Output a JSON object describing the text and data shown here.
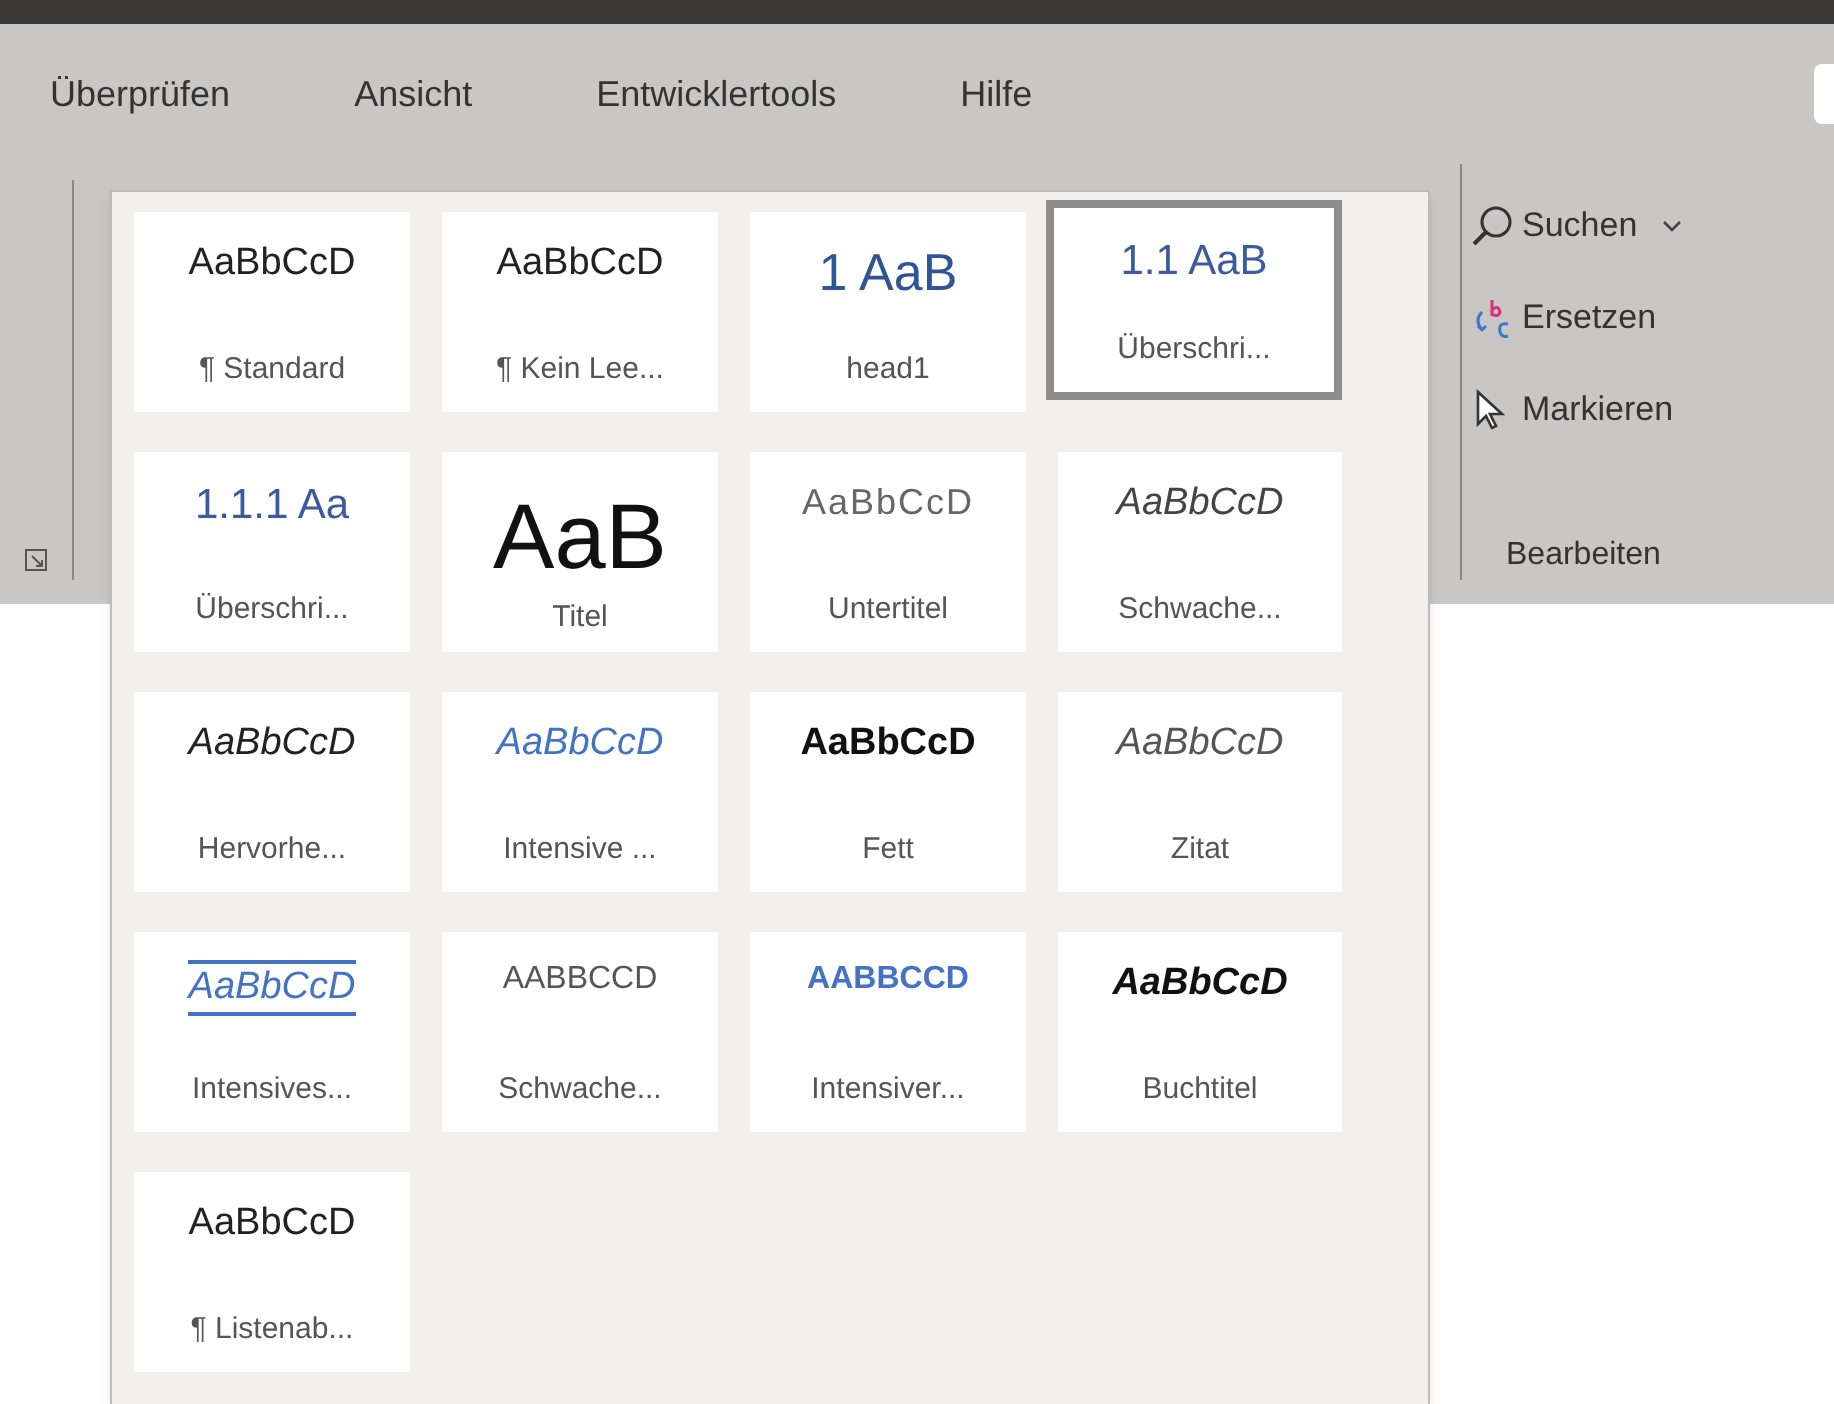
{
  "ribbon_tabs": [
    "Überprüfen",
    "Ansicht",
    "Entwicklertools",
    "Hilfe"
  ],
  "style_gallery": [
    {
      "sample": "AaBbCcD",
      "label": "¶ Standard",
      "kind": "normal",
      "selected": false
    },
    {
      "sample": "AaBbCcD",
      "label": "¶ Kein Lee...",
      "kind": "normal",
      "selected": false
    },
    {
      "sample": "1  AaB",
      "label": "head1",
      "kind": "heading",
      "selected": false
    },
    {
      "sample": "1.1  AaB",
      "label": "Überschri...",
      "kind": "heading2",
      "selected": true
    },
    {
      "sample": "1.1.1  Aa",
      "label": "Überschri...",
      "kind": "heading2",
      "selected": false
    },
    {
      "sample": "AaB",
      "label": "Titel",
      "kind": "title",
      "selected": false
    },
    {
      "sample": "AaBbCcD",
      "label": "Untertitel",
      "kind": "subtitle",
      "selected": false
    },
    {
      "sample": "AaBbCcD",
      "label": "Schwache...",
      "kind": "subtle",
      "selected": false
    },
    {
      "sample": "AaBbCcD",
      "label": "Hervorhe...",
      "kind": "emphasis",
      "selected": false
    },
    {
      "sample": "AaBbCcD",
      "label": "Intensive ...",
      "kind": "intense",
      "selected": false
    },
    {
      "sample": "AaBbCcD",
      "label": "Fett",
      "kind": "strong",
      "selected": false
    },
    {
      "sample": "AaBbCcD",
      "label": "Zitat",
      "kind": "quote",
      "selected": false
    },
    {
      "sample": "AaBbCcD",
      "label": "Intensives...",
      "kind": "intense-quote",
      "selected": false
    },
    {
      "sample": "AABBCCD",
      "label": "Schwache...",
      "kind": "subtle-ref",
      "selected": false
    },
    {
      "sample": "AABBCCD",
      "label": "Intensiver...",
      "kind": "intense-ref",
      "selected": false
    },
    {
      "sample": "AaBbCcD",
      "label": "Buchtitel",
      "kind": "book",
      "selected": false
    },
    {
      "sample": "AaBbCcD",
      "label": "¶ Listenab...",
      "kind": "normal",
      "selected": false
    }
  ],
  "editing_group": {
    "items": [
      {
        "label": "Suchen",
        "kind": "search"
      },
      {
        "label": "Ersetzen",
        "kind": "replace"
      },
      {
        "label": "Markieren",
        "kind": "select"
      }
    ],
    "title": "Bearbeiten"
  }
}
